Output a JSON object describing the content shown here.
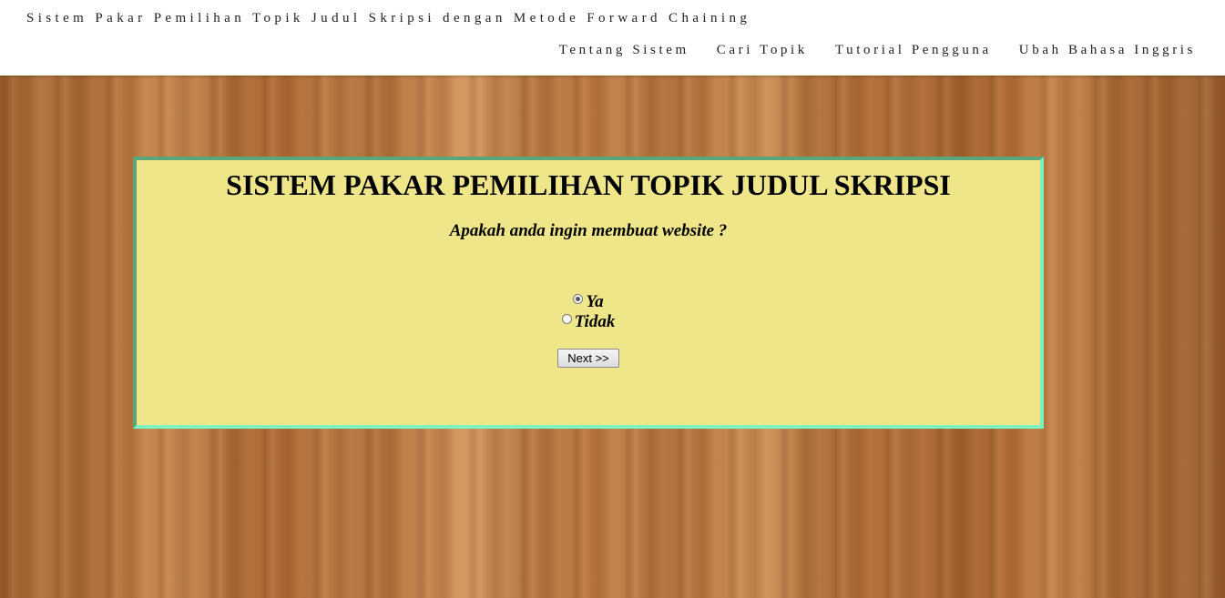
{
  "header": {
    "brand": "Sistem Pakar Pemilihan Topik Judul Skripsi dengan Metode Forward Chaining",
    "nav": [
      {
        "label": "Tentang Sistem"
      },
      {
        "label": "Cari Topik"
      },
      {
        "label": "Tutorial Pengguna"
      },
      {
        "label": "Ubah Bahasa Inggris"
      }
    ]
  },
  "panel": {
    "title": "SISTEM PAKAR PEMILIHAN TOPIK JUDUL SKRIPSI",
    "question": "Apakah anda ingin membuat website ?",
    "options": [
      {
        "label": "Ya",
        "checked": true
      },
      {
        "label": "Tidak",
        "checked": false
      }
    ],
    "next_label": "Next >>"
  },
  "colors": {
    "panel_bg": "#efe68a",
    "panel_border_light": "#7ef3c0",
    "panel_border_dark": "#5aa57a",
    "wood": "#b9743c"
  }
}
